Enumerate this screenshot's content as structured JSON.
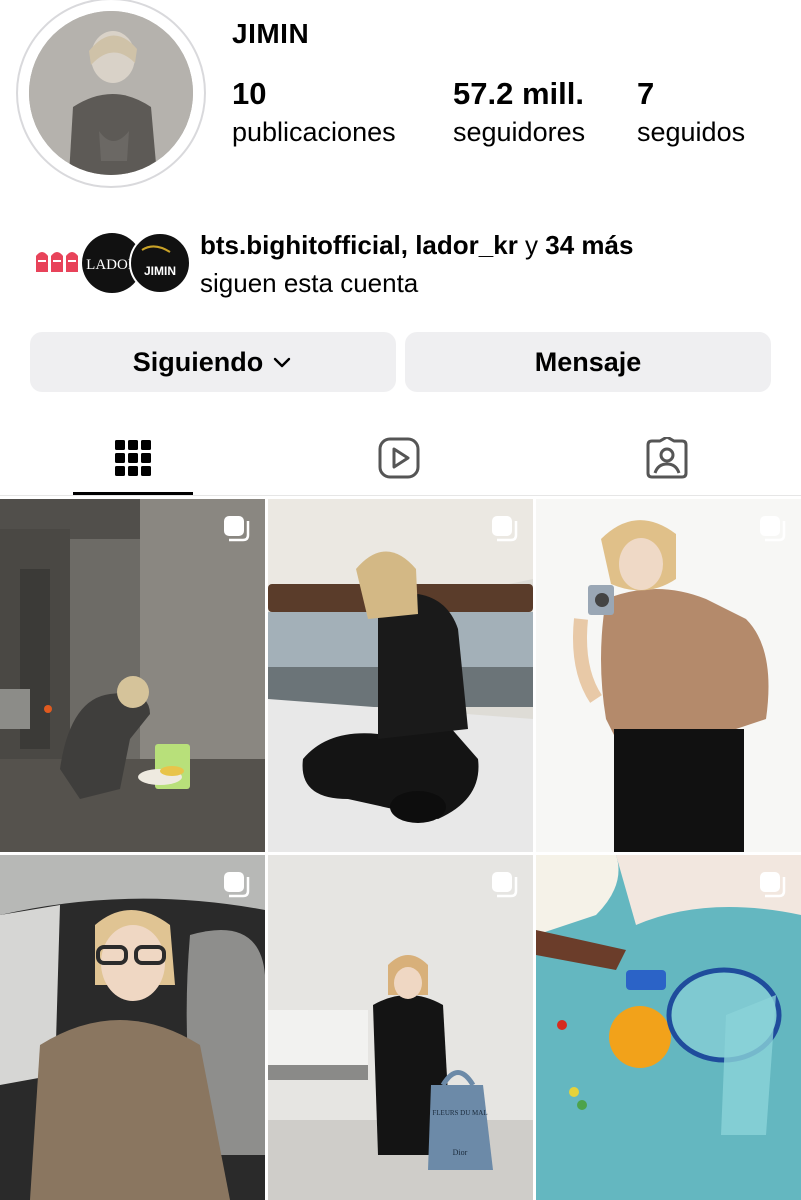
{
  "profile": {
    "username": "JIMIN",
    "stats": [
      {
        "value": "10",
        "label": "publicaciones"
      },
      {
        "value": "57.2 mill.",
        "label": "seguidores"
      },
      {
        "value": "7",
        "label": "seguidos"
      }
    ],
    "mutual": {
      "accounts": "bts.bighitofficial, lador_kr",
      "conjunction": " y ",
      "more": "34 más",
      "line2": "siguen esta cuenta"
    },
    "follower_badges": [
      "LADOR",
      "JIMIN"
    ]
  },
  "actions": {
    "following_label": "Siguiendo",
    "message_label": "Mensaje"
  },
  "tabs": [
    {
      "icon": "grid-icon",
      "active": true
    },
    {
      "icon": "reels-icon",
      "active": false
    },
    {
      "icon": "tagged-icon",
      "active": false
    }
  ],
  "posts": [
    {
      "desc": "hallway crouching",
      "multi": true
    },
    {
      "desc": "sailboat seated",
      "multi": true
    },
    {
      "desc": "camera white studio",
      "multi": true
    },
    {
      "desc": "car selfie",
      "multi": true
    },
    {
      "desc": "studio seated tote",
      "multi": true
    },
    {
      "desc": "table flowers fruit",
      "multi": true
    }
  ],
  "post_texts": {
    "tote_bag": "FLEURS DU MAL",
    "tote_brand": "Dior"
  },
  "colors": {
    "button_bg": "#efeff1",
    "text": "#000000",
    "divider": "#e6e6e6"
  }
}
